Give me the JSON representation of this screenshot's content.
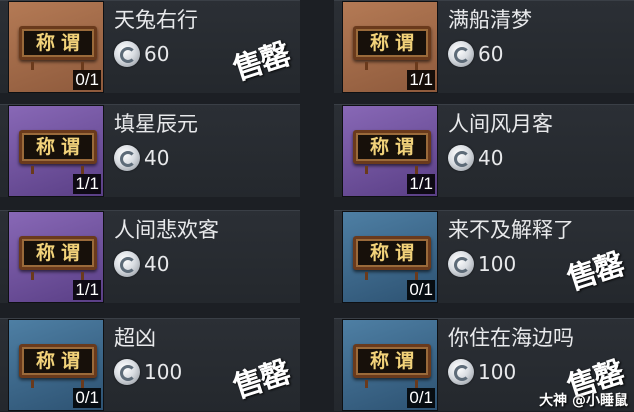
{
  "badge_text": "称谓",
  "sold_stamp": "售罄",
  "watermark": "大神 @小睡鼠",
  "items": [
    {
      "name": "天兔右行",
      "price": "60",
      "count": "0/1",
      "sold": true,
      "rarity_color": "#b47a55"
    },
    {
      "name": "满船清梦",
      "price": "60",
      "count": "1/1",
      "sold": false,
      "rarity_color": "#b47a55"
    },
    {
      "name": "填星辰元",
      "price": "40",
      "count": "1/1",
      "sold": false,
      "rarity_color": "#8868b6"
    },
    {
      "name": "人间风月客",
      "price": "40",
      "count": "1/1",
      "sold": false,
      "rarity_color": "#8868b6"
    },
    {
      "name": "人间悲欢客",
      "price": "40",
      "count": "1/1",
      "sold": false,
      "rarity_color": "#8868b6"
    },
    {
      "name": "来不及解释了",
      "price": "100",
      "count": "0/1",
      "sold": true,
      "rarity_color": "#4e7fa4"
    },
    {
      "name": "超凶",
      "price": "100",
      "count": "0/1",
      "sold": true,
      "rarity_color": "#4e7fa4"
    },
    {
      "name": "你住在海边吗",
      "price": "100",
      "count": "0/1",
      "sold": true,
      "rarity_color": "#4e7fa4"
    }
  ],
  "currency_icon": "silver-coin-icon"
}
